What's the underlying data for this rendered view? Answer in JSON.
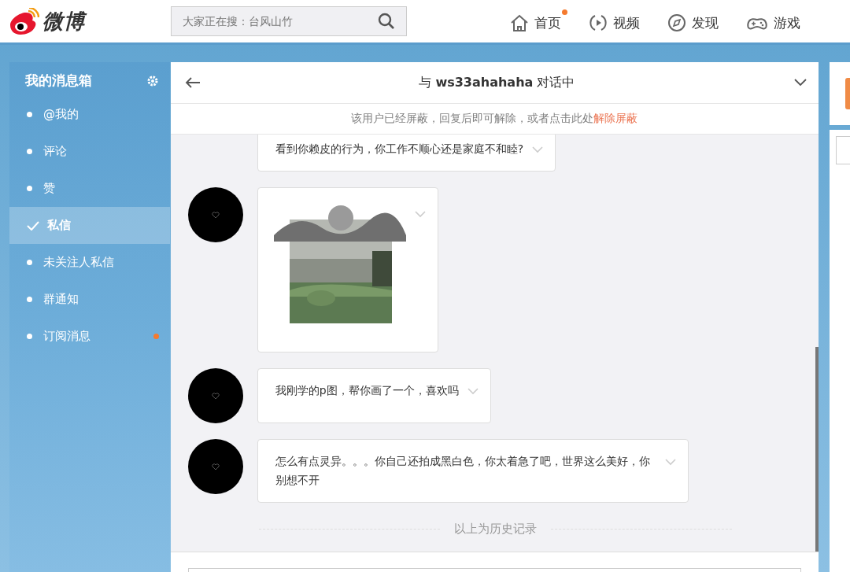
{
  "header": {
    "logo_text": "微博",
    "search": {
      "placeholder": "大家正在搜：台风山竹"
    },
    "nav": [
      {
        "label": "首页",
        "badge": true
      },
      {
        "label": "视频",
        "badge": false
      },
      {
        "label": "发现",
        "badge": false
      },
      {
        "label": "游戏",
        "badge": false
      }
    ]
  },
  "sidebar": {
    "title": "我的消息箱",
    "items": [
      {
        "label": "@我的",
        "selected": false,
        "badge": false
      },
      {
        "label": "评论",
        "selected": false,
        "badge": false
      },
      {
        "label": "赞",
        "selected": false,
        "badge": false
      },
      {
        "label": "私信",
        "selected": true,
        "badge": false
      },
      {
        "label": "未关注人私信",
        "selected": false,
        "badge": false
      },
      {
        "label": "群通知",
        "selected": false,
        "badge": false
      },
      {
        "label": "订阅消息",
        "selected": false,
        "badge": true
      }
    ]
  },
  "chat": {
    "title": "与 **ws33ahahaha** 对话中",
    "notice": {
      "text": "该用户已经屏蔽，回复后即可解除，或者点击此处",
      "link": "解除屏蔽"
    },
    "messages": [
      {
        "kind": "text",
        "avatar": false,
        "text": "看到你赖皮的行为，你工作不顺心还是家庭不和睦?"
      },
      {
        "kind": "picture",
        "avatar": true
      },
      {
        "kind": "text",
        "avatar": true,
        "text": "我刚学的p图，帮你画了一个，喜欢吗"
      },
      {
        "kind": "text",
        "avatar": true,
        "text": "怎么有点灵异。。。你自己还拍成黑白色，你太着急了吧，世界这么美好，你别想不开"
      }
    ],
    "history_label": "以上为历史记录"
  }
}
